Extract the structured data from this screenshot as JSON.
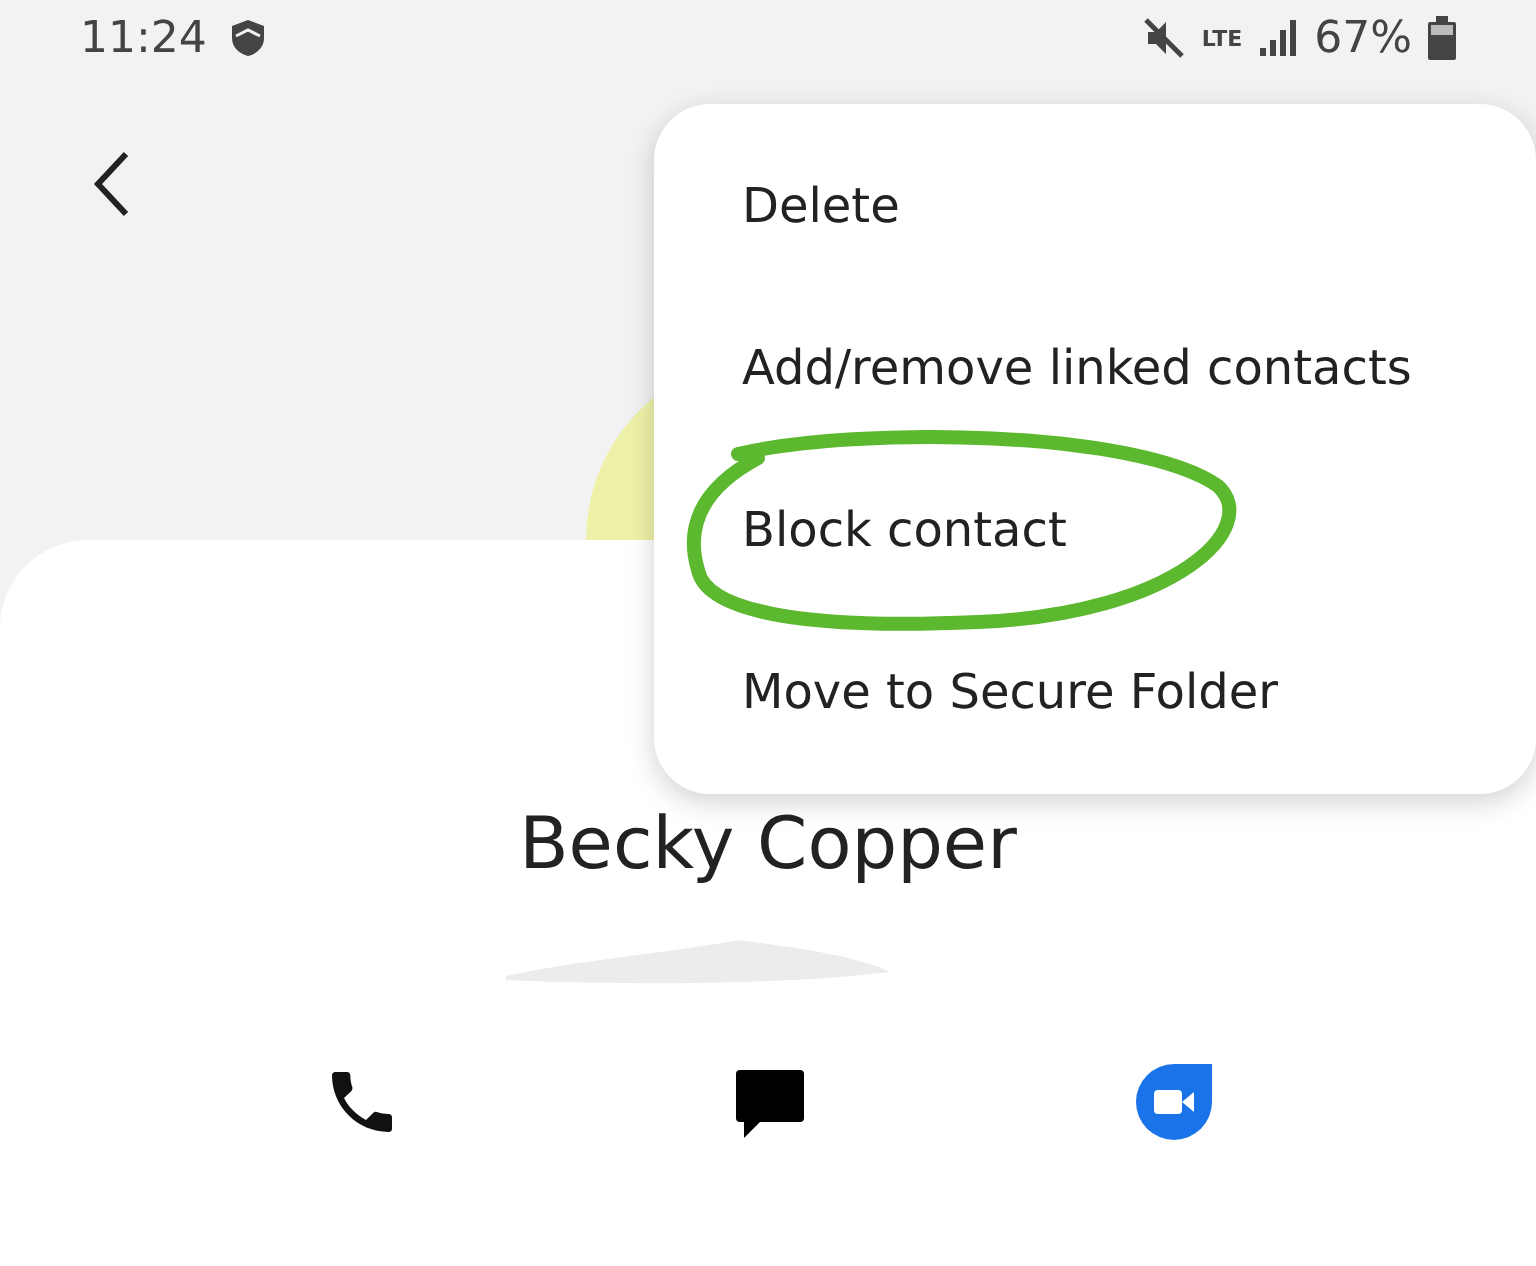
{
  "status_bar": {
    "time": "11:24",
    "network": "LTE",
    "battery": "67%"
  },
  "menu": {
    "items": [
      {
        "label": "Delete",
        "circled": false
      },
      {
        "label": "Add/remove linked contacts",
        "circled": false
      },
      {
        "label": "Block contact",
        "circled": true
      },
      {
        "label": "Move to Secure Folder",
        "circled": false
      }
    ]
  },
  "contact": {
    "name": "Becky Copper"
  },
  "actions": [
    {
      "kind": "call"
    },
    {
      "kind": "message"
    },
    {
      "kind": "video"
    }
  ]
}
